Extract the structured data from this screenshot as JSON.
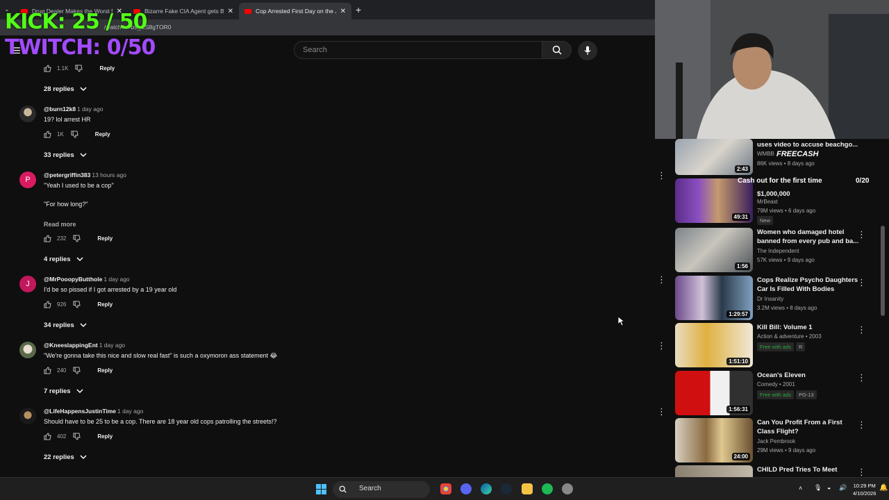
{
  "overlay": {
    "kick": "KICK: 25 / 50",
    "twitch": "TWITCH: 0/50"
  },
  "browser": {
    "tabs": [
      {
        "title": "Drug Dealer Makes the Worst Mi"
      },
      {
        "title": "Bizarre Fake CIA Agent gets Buste"
      },
      {
        "title": "Cop Arrested First Day on the Job"
      }
    ],
    "url": "/watch?v=b9_CS8gTOR0"
  },
  "header": {
    "search_placeholder": "Search"
  },
  "top_actions": {
    "likes": "1.1K",
    "reply": "Reply",
    "replies": "28 replies"
  },
  "comments": [
    {
      "handle": "@burn12k8",
      "date": "1 day ago",
      "lines": [
        "19? lol arrest HR"
      ],
      "likes": "1K",
      "reply": "Reply",
      "replies": "33 replies",
      "avatar_letter": ""
    },
    {
      "handle": "@petergriffin383",
      "date": "13 hours ago",
      "lines": [
        "\"Yeah I used to be a cop\"",
        "\"For how long?\""
      ],
      "read_more": "Read more",
      "likes": "232",
      "reply": "Reply",
      "replies": "4 replies",
      "avatar_letter": "P"
    },
    {
      "handle": "@MrPooopyButthole",
      "date": "1 day ago",
      "lines": [
        "I'd be so pissed if I got arrested by a 19 year old"
      ],
      "likes": "926",
      "reply": "Reply",
      "replies": "34 replies",
      "avatar_letter": "J"
    },
    {
      "handle": "@KneeslappingEnt",
      "date": "1 day ago",
      "lines": [
        "\"We're gonna take this nice and slow real fast\" is such a oxymoron ass statement 😂"
      ],
      "likes": "240",
      "reply": "Reply",
      "replies": "7 replies",
      "avatar_letter": ""
    },
    {
      "handle": "@LifeHappensJustinTime",
      "date": "1 day ago",
      "lines": [
        "Should have to be 25 to be a cop. There are 18 year old cops patrolling the streets!?"
      ],
      "likes": "402",
      "reply": "Reply",
      "replies": "22 replies",
      "avatar_letter": ""
    }
  ],
  "sidebar": [
    {
      "title": "uses video to accuse beachgo...",
      "channel": "WMBB",
      "stats": "86K views • 8 days ago",
      "duration": "2:43",
      "badges": []
    },
    {
      "title": "$1,000,000",
      "channel": "MrBeast",
      "stats": "79M views • 6 days ago",
      "duration": "49:31",
      "badges": [
        "New"
      ]
    },
    {
      "title": "Women who damaged hotel banned from every pub and ba...",
      "channel": "The Independent",
      "stats": "57K views • 9 days ago",
      "duration": "1:56",
      "badges": []
    },
    {
      "title": "Cops Realize Psycho Daughters Car Is Filled With Bodies",
      "channel": "Dr Insanity",
      "stats": "3.2M views • 8 days ago",
      "duration": "1:29:57",
      "badges": []
    },
    {
      "title": "Kill Bill: Volume 1",
      "channel": "Action & adventure • 2003",
      "stats": "",
      "duration": "1:51:10",
      "badges": [
        "Free with ads",
        "R"
      ]
    },
    {
      "title": "Ocean's Eleven",
      "channel": "Comedy • 2001",
      "stats": "",
      "duration": "1:56:31",
      "badges": [
        "Free with ads",
        "PG-13"
      ]
    },
    {
      "title": "Can You Profit From a First Class Flight?",
      "channel": "Jack Pembrook",
      "stats": "29M views • 9 days ago",
      "duration": "24:00",
      "badges": []
    },
    {
      "title": "CHILD Pred Tries To Meet",
      "channel": "",
      "stats": "",
      "duration": "",
      "badges": []
    }
  ],
  "freecash": {
    "brand": "FREECASH",
    "text": "Cash out for the first time",
    "count": "0/20"
  },
  "taskbar": {
    "search": "Search",
    "time": "10:29 PM",
    "date": "4/10/2026"
  },
  "colors": {
    "accent": "#ff0000",
    "kick": "#53fc18",
    "twitch": "#a24bff",
    "free": "#2ba640"
  }
}
